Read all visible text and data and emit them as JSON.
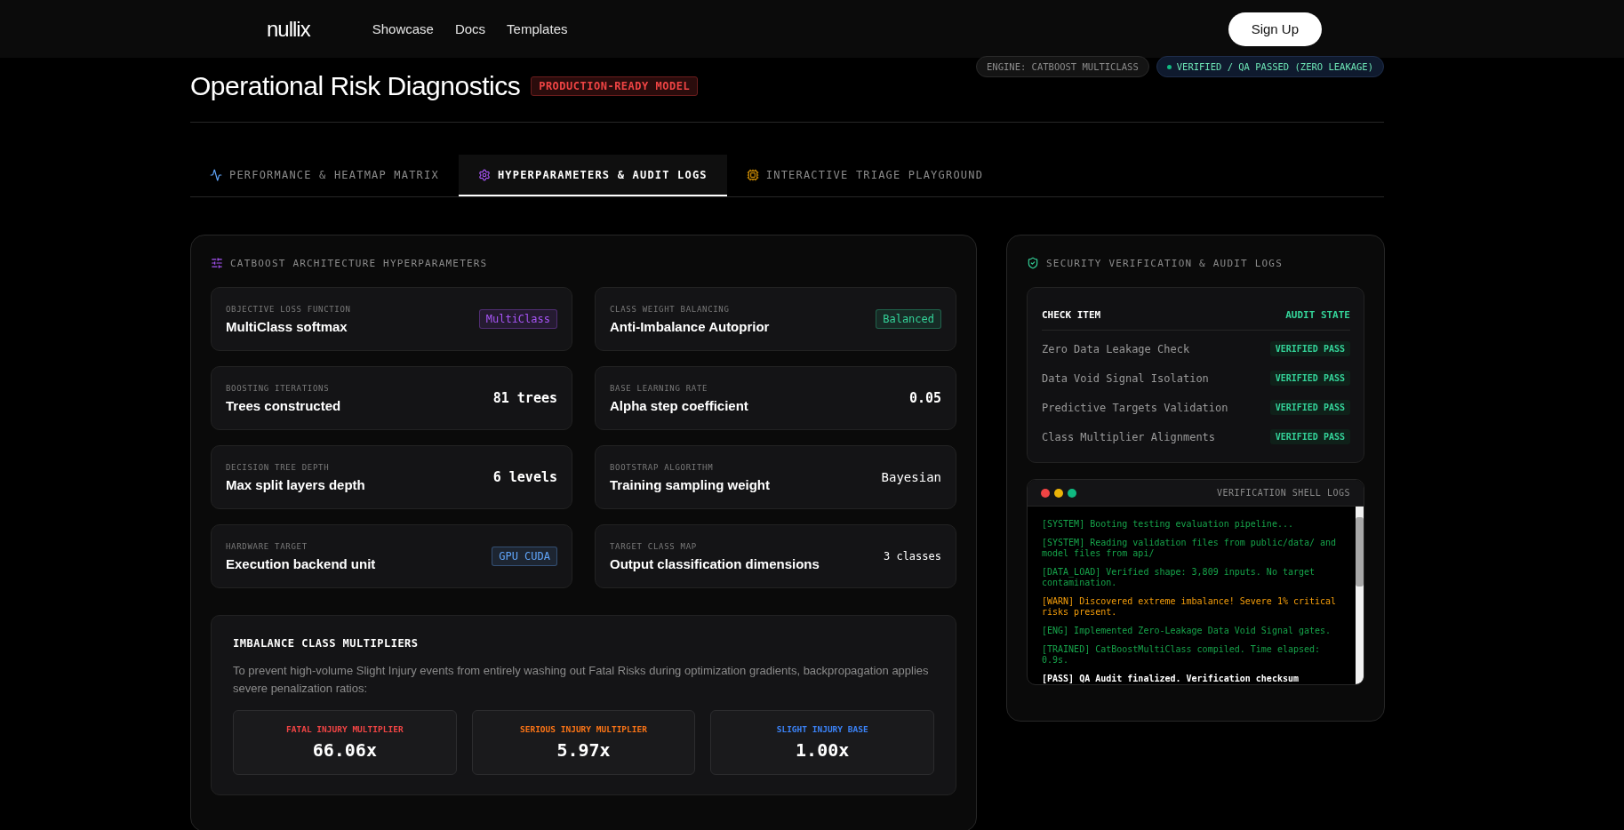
{
  "nav": {
    "logo": "nullix",
    "links": [
      "Showcase",
      "Docs",
      "Templates"
    ],
    "cta": "Sign Up"
  },
  "header": {
    "title": "Operational Risk Diagnostics",
    "badge": "PRODUCTION-READY MODEL",
    "pills": [
      {
        "kind": "neutral",
        "label": "ENGINE: CATBOOST MULTICLASS"
      },
      {
        "kind": "status",
        "label": "VERIFIED / QA PASSED (ZERO LEAKAGE)"
      }
    ]
  },
  "tabs": [
    {
      "label": "PERFORMANCE & HEATMAP MATRIX",
      "kind": "performance",
      "selected": false
    },
    {
      "label": "HYPERPARAMETERS & AUDIT LOGS",
      "kind": "settings",
      "selected": true
    },
    {
      "label": "INTERACTIVE TRIAGE PLAYGROUND",
      "kind": "playground",
      "selected": false
    }
  ],
  "hyperparameters": {
    "title": "CATBOOST ARCHITECTURE HYPERPARAMETERS",
    "items": [
      {
        "label": "OBJECTIVE LOSS FUNCTION",
        "name": "MultiClass softmax",
        "value": "MultiClass",
        "kind": "badge",
        "color": "#a855f7"
      },
      {
        "label": "CLASS WEIGHT BALANCING",
        "name": "Anti-Imbalance Autoprior",
        "value": "Balanced",
        "kind": "badge",
        "color": "#34d399"
      },
      {
        "label": "BOOSTING ITERATIONS",
        "name": "Trees constructed",
        "value": "81 trees",
        "kind": "bold"
      },
      {
        "label": "BASE LEARNING RATE",
        "name": "Alpha step coefficient",
        "value": "0.05",
        "kind": "bold"
      },
      {
        "label": "DECISION TREE DEPTH",
        "name": "Max split layers depth",
        "value": "6 levels",
        "kind": "bold"
      },
      {
        "label": "BOOTSTRAP ALGORITHM",
        "name": "Training sampling weight",
        "value": "Bayesian",
        "kind": "plain"
      },
      {
        "label": "HARDWARE TARGET",
        "name": "Execution backend unit",
        "value": "GPU CUDA",
        "kind": "badge",
        "color": "#60a5fa"
      },
      {
        "label": "TARGET CLASS MAP",
        "name": "Output classification dimensions",
        "value": "3 classes",
        "kind": "small"
      }
    ]
  },
  "multipliers": {
    "title": "IMBALANCE CLASS MULTIPLIERS",
    "description": "To prevent high-volume Slight Injury events from entirely washing out Fatal Risks during optimization gradients, backpropagation applies severe penalization ratios:",
    "items": [
      {
        "label": "FATAL INJURY MULTIPLIER",
        "value": "66.06x",
        "color": "#ef4444"
      },
      {
        "label": "SERIOUS INJURY MULTIPLIER",
        "value": "5.97x",
        "color": "#f97316"
      },
      {
        "label": "SLIGHT INJURY BASE",
        "value": "1.00x",
        "color": "#3b82f6"
      }
    ]
  },
  "audit": {
    "title": "SECURITY VERIFICATION & AUDIT LOGS",
    "columns": [
      "CHECK ITEM",
      "AUDIT STATE"
    ],
    "rows": [
      {
        "item": "Zero Data Leakage Check",
        "state": "VERIFIED PASS"
      },
      {
        "item": "Data Void Signal Isolation",
        "state": "VERIFIED PASS"
      },
      {
        "item": "Predictive Targets Validation",
        "state": "VERIFIED PASS"
      },
      {
        "item": "Class Multiplier Alignments",
        "state": "VERIFIED PASS"
      }
    ]
  },
  "terminal": {
    "title": "VERIFICATION SHELL LOGS",
    "lines": [
      {
        "kind": "info",
        "text": "[SYSTEM] Booting testing evaluation pipeline..."
      },
      {
        "kind": "info",
        "text": "[SYSTEM] Reading validation files from public/data/ and model files from api/"
      },
      {
        "kind": "info",
        "text": "[DATA_LOAD] Verified shape: 3,809 inputs. No target contamination."
      },
      {
        "kind": "warn",
        "text": "[WARN] Discovered extreme imbalance! Severe 1% critical risks present."
      },
      {
        "kind": "info",
        "text": "[ENG] Implemented Zero-Leakage Data Void Signal gates."
      },
      {
        "kind": "info",
        "text": "[TRAINED] CatBoostMultiClass compiled. Time elapsed: 0.9s."
      },
      {
        "kind": "pass",
        "text": "[PASS] QA Audit finalized. Verification checksum"
      }
    ]
  }
}
